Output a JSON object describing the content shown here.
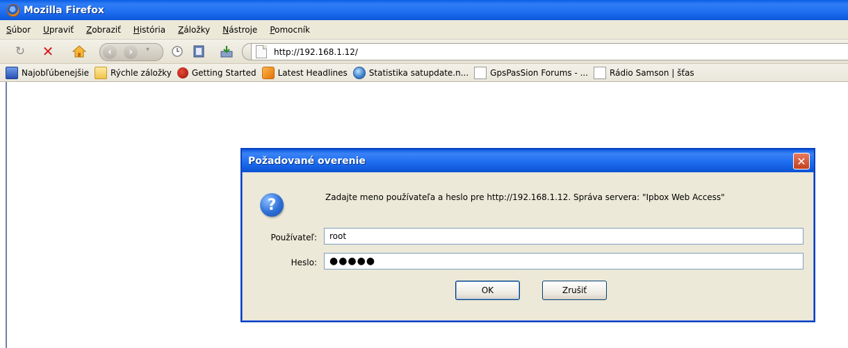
{
  "window": {
    "title": "Mozilla Firefox"
  },
  "menu": [
    "Súbor",
    "Upraviť",
    "Zobraziť",
    "História",
    "Záložky",
    "Nástroje",
    "Pomocník"
  ],
  "navbar": {
    "url": "http://192.168.1.12/"
  },
  "bookmarks": [
    {
      "label": "Najobľúbenejšie",
      "icon": "blue-folder-icon"
    },
    {
      "label": "Rýchle záložky",
      "icon": "folder-icon"
    },
    {
      "label": "Getting Started",
      "icon": "red-bird-icon"
    },
    {
      "label": "Latest Headlines",
      "icon": "rss-icon"
    },
    {
      "label": "Statistika satupdate.n...",
      "icon": "globe-icon"
    },
    {
      "label": "GpsPasSion Forums - ...",
      "icon": "page-icon"
    },
    {
      "label": "Rádio Samson | šťas",
      "icon": "page-icon"
    }
  ],
  "dialog": {
    "title": "Požadované overenie",
    "message": "Zadajte meno používateľa a heslo pre http://192.168.1.12. Správa servera: \"Ipbox Web Access\"",
    "user_label": "Používateľ:",
    "user_value": "root",
    "password_label": "Heslo:",
    "password_value": "●●●●●",
    "ok_label": "OK",
    "cancel_label": "Zrušiť",
    "close_glyph": "✕",
    "question_glyph": "?"
  },
  "colors": {
    "titlebar": "#1f6ef0",
    "chrome": "#ece9d8",
    "close": "#c4411e"
  }
}
